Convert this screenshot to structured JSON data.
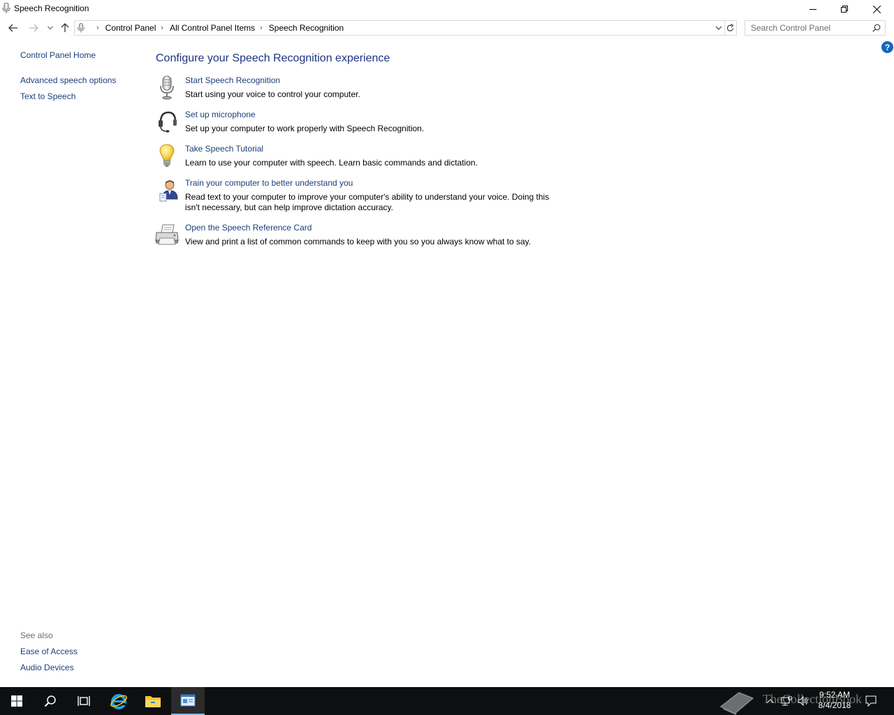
{
  "window": {
    "title": "Speech Recognition",
    "minimize_icon": "minimize-icon",
    "restore_icon": "restore-icon",
    "close_icon": "close-icon"
  },
  "navigation": {
    "breadcrumbs": [
      "Control Panel",
      "All Control Panel Items",
      "Speech Recognition"
    ],
    "search_placeholder": "Search Control Panel"
  },
  "sidebar": {
    "home": "Control Panel Home",
    "links": [
      "Advanced speech options",
      "Text to Speech"
    ],
    "see_also_label": "See also",
    "see_also_links": [
      "Ease of Access",
      "Audio Devices"
    ]
  },
  "main": {
    "heading": "Configure your Speech Recognition experience",
    "help_label": "?",
    "tasks": [
      {
        "icon": "microphone-icon",
        "title": "Start Speech Recognition",
        "description": "Start using your voice to control your computer."
      },
      {
        "icon": "headset-icon",
        "title": "Set up microphone",
        "description": "Set up your computer to work properly with Speech Recognition."
      },
      {
        "icon": "lightbulb-icon",
        "title": "Take Speech Tutorial",
        "description": "Learn to use your computer with speech.  Learn basic commands and dictation."
      },
      {
        "icon": "user-training-icon",
        "title": "Train your computer to better understand you",
        "description": "Read text to your computer to improve your computer's ability to understand your voice.  Doing this isn't necessary, but can help improve dictation accuracy."
      },
      {
        "icon": "printer-icon",
        "title": "Open the Speech Reference Card",
        "description": "View and print a list of common commands to keep with you so you always know what to say."
      }
    ]
  },
  "taskbar": {
    "time": "9:52 AM",
    "date": "8/4/2018",
    "watermark": "TheCollectionBook"
  }
}
